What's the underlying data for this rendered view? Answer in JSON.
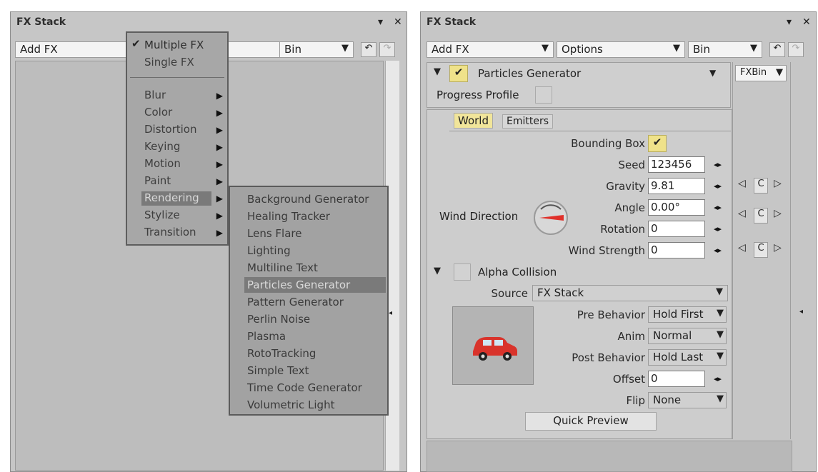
{
  "left": {
    "title": "FX Stack",
    "add_fx": "Add FX",
    "bin": "Bin",
    "close_glyph": "✕",
    "menu_glyph": "▾",
    "menu": {
      "multiple_fx": "Multiple FX",
      "single_fx": "Single FX",
      "categories": [
        "Blur",
        "Color",
        "Distortion",
        "Keying",
        "Motion",
        "Paint",
        "Rendering",
        "Stylize",
        "Transition"
      ],
      "selected_category": "Rendering"
    },
    "submenu": {
      "items": [
        "Background Generator",
        "Healing Tracker",
        "Lens Flare",
        "Lighting",
        "Multiline Text",
        "Particles Generator",
        "Pattern Generator",
        "Perlin Noise",
        "Plasma",
        "RotoTracking",
        "Simple Text",
        "Time Code Generator",
        "Volumetric Light"
      ],
      "highlighted": "Particles Generator"
    }
  },
  "right": {
    "title": "FX Stack",
    "close_glyph": "✕",
    "menu_glyph": "▾",
    "add_fx": "Add FX",
    "options": "Options",
    "bin": "Bin",
    "fxbin": "FXBin",
    "effect_name": "Particles Generator",
    "progress_profile": "Progress Profile",
    "tabs": [
      "World",
      "Emitters"
    ],
    "active_tab": "World",
    "bounding_box": "Bounding Box",
    "seed_label": "Seed",
    "seed_value": "123456",
    "gravity_label": "Gravity",
    "gravity_value": "9.81",
    "wind_direction": "Wind Direction",
    "angle_label": "Angle",
    "angle_value": "0.00°",
    "rotation_label": "Rotation",
    "rotation_value": "0",
    "wind_strength_label": "Wind Strength",
    "wind_strength_value": "0",
    "keyframe_c": "C",
    "alpha_collision": "Alpha Collision",
    "source_label": "Source",
    "source_value": "FX Stack",
    "pre_behavior_label": "Pre Behavior",
    "pre_behavior_value": "Hold First",
    "anim_label": "Anim",
    "anim_value": "Normal",
    "post_behavior_label": "Post Behavior",
    "post_behavior_value": "Hold Last",
    "offset_label": "Offset",
    "offset_value": "0",
    "flip_label": "Flip",
    "flip_value": "None",
    "quick_preview": "Quick Preview"
  },
  "colors": {
    "panel_bg": "#c6c6c6",
    "menu_bg": "#a7a7a7",
    "highlight": "#7a7a7a",
    "check_yellow": "#efe28a",
    "tab_yellow": "#f1e59a",
    "wind_red": "#e0302a"
  },
  "icons": [
    "checkmark-icon",
    "submenu-arrow-icon",
    "close-icon",
    "menu-arrow-icon",
    "undo-icon",
    "redo-icon",
    "eye-link-icon",
    "triangle-left-icon",
    "triangle-right-icon",
    "expand-triangle-icon",
    "car-thumbnail-icon"
  ]
}
